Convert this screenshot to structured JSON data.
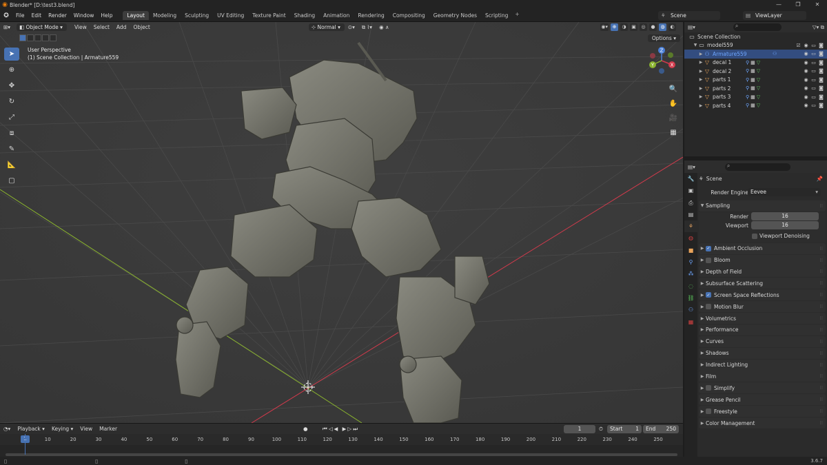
{
  "titlebar": {
    "title": "Blender* [D:\\test3.blend]",
    "min": "—",
    "max": "❐",
    "close": "✕"
  },
  "menu": [
    "File",
    "Edit",
    "Render",
    "Window",
    "Help"
  ],
  "workspaces": [
    "Layout",
    "Modeling",
    "Sculpting",
    "UV Editing",
    "Texture Paint",
    "Shading",
    "Animation",
    "Rendering",
    "Compositing",
    "Geometry Nodes",
    "Scripting"
  ],
  "workspace_add": "+",
  "scene": {
    "name": "Scene",
    "view_layer": "ViewLayer"
  },
  "viewport": {
    "mode": "Object Mode",
    "menus": [
      "View",
      "Select",
      "Add",
      "Object"
    ],
    "orientation": "Normal",
    "perspective": "User Perspective",
    "collection_info": "(1) Scene Collection | Armature559",
    "options": "Options",
    "gizmo": {
      "x": "X",
      "y": "Y",
      "z": "Z"
    }
  },
  "outliner": {
    "root": "Scene Collection",
    "collection": "model559",
    "items": [
      {
        "label": "Armature559",
        "selected": true,
        "type": "armature"
      },
      {
        "label": "decal 1",
        "selected": false,
        "type": "mesh"
      },
      {
        "label": "decal 2",
        "selected": false,
        "type": "mesh"
      },
      {
        "label": "parts 1",
        "selected": false,
        "type": "mesh"
      },
      {
        "label": "parts 2",
        "selected": false,
        "type": "mesh"
      },
      {
        "label": "parts 3",
        "selected": false,
        "type": "mesh"
      },
      {
        "label": "parts 4",
        "selected": false,
        "type": "mesh"
      }
    ]
  },
  "properties": {
    "context": "Scene",
    "render_engine_label": "Render Engine",
    "render_engine": "Eevee",
    "sampling": {
      "title": "Sampling",
      "render_label": "Render",
      "render": "16",
      "viewport_label": "Viewport",
      "viewport": "16",
      "denoise": "Viewport Denoising"
    },
    "panels": [
      {
        "label": "Ambient Occlusion",
        "checkbox": true,
        "checked": true
      },
      {
        "label": "Bloom",
        "checkbox": true,
        "checked": false
      },
      {
        "label": "Depth of Field",
        "checkbox": false
      },
      {
        "label": "Subsurface Scattering",
        "checkbox": false
      },
      {
        "label": "Screen Space Reflections",
        "checkbox": true,
        "checked": true
      },
      {
        "label": "Motion Blur",
        "checkbox": true,
        "checked": false
      },
      {
        "label": "Volumetrics",
        "checkbox": false
      },
      {
        "label": "Performance",
        "checkbox": false
      },
      {
        "label": "Curves",
        "checkbox": false
      },
      {
        "label": "Shadows",
        "checkbox": false
      },
      {
        "label": "Indirect Lighting",
        "checkbox": false
      },
      {
        "label": "Film",
        "checkbox": false
      },
      {
        "label": "Simplify",
        "checkbox": true,
        "checked": false
      },
      {
        "label": "Grease Pencil",
        "checkbox": false
      },
      {
        "label": "Freestyle",
        "checkbox": true,
        "checked": false
      },
      {
        "label": "Color Management",
        "checkbox": false
      }
    ]
  },
  "timeline": {
    "menus": [
      "Playback",
      "Keying",
      "View",
      "Marker"
    ],
    "current_frame": "1",
    "start_label": "Start",
    "start": "1",
    "end_label": "End",
    "end": "250",
    "ticks": [
      "1",
      "10",
      "20",
      "30",
      "40",
      "50",
      "60",
      "70",
      "80",
      "90",
      "100",
      "110",
      "120",
      "130",
      "140",
      "150",
      "160",
      "170",
      "180",
      "190",
      "200",
      "210",
      "220",
      "230",
      "240",
      "250"
    ]
  },
  "status": {
    "version": "3.6.7"
  },
  "colors": {
    "accent": "#4772b3",
    "selected_text": "#6ea6ff",
    "x_axis": "#d23a4c",
    "y_axis": "#8ab32e"
  }
}
